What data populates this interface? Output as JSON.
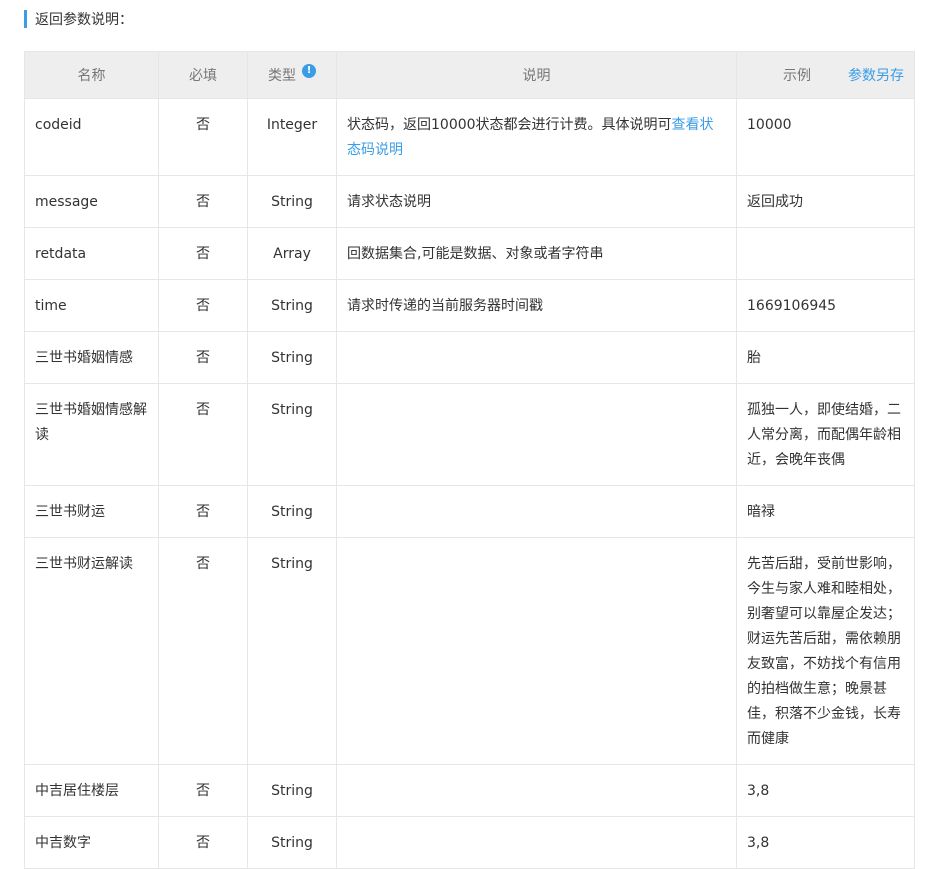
{
  "section": {
    "title": "返回参数说明："
  },
  "table": {
    "headers": {
      "name": "名称",
      "required": "必填",
      "type": "类型",
      "desc": "说明",
      "example": "示例",
      "save": "参数另存"
    },
    "rows": [
      {
        "name": "codeid",
        "required": "否",
        "type": "Integer",
        "desc": "状态码，返回10000状态都会进行计费。具体说明可",
        "desc_link": "查看状态码说明",
        "example": "10000"
      },
      {
        "name": "message",
        "required": "否",
        "type": "String",
        "desc": "请求状态说明",
        "example": "返回成功"
      },
      {
        "name": "retdata",
        "required": "否",
        "type": "Array",
        "desc": "回数据集合,可能是数据、对象或者字符串",
        "example": ""
      },
      {
        "name": "time",
        "required": "否",
        "type": "String",
        "desc": "请求时传递的当前服务器时间戳",
        "example": "1669106945"
      },
      {
        "name": "三世书婚姻情感",
        "required": "否",
        "type": "String",
        "desc": "",
        "example": "胎"
      },
      {
        "name": "三世书婚姻情感解读",
        "required": "否",
        "type": "String",
        "desc": "",
        "example": "孤独一人，即使结婚，二人常分离，而配偶年龄相近，会晚年丧偶"
      },
      {
        "name": "三世书财运",
        "required": "否",
        "type": "String",
        "desc": "",
        "example": "暗禄"
      },
      {
        "name": "三世书财运解读",
        "required": "否",
        "type": "String",
        "desc": "",
        "example": "先苦后甜，受前世影响，今生与家人难和睦相处，别奢望可以靠屋企发达；财运先苦后甜，需依赖朋友致富，不妨找个有信用的拍档做生意；晚景甚佳，积落不少金钱，长寿而健康"
      },
      {
        "name": "中吉居住楼层",
        "required": "否",
        "type": "String",
        "desc": "",
        "example": "3,8"
      },
      {
        "name": "中吉数字",
        "required": "否",
        "type": "String",
        "desc": "",
        "example": "3,8"
      }
    ]
  }
}
